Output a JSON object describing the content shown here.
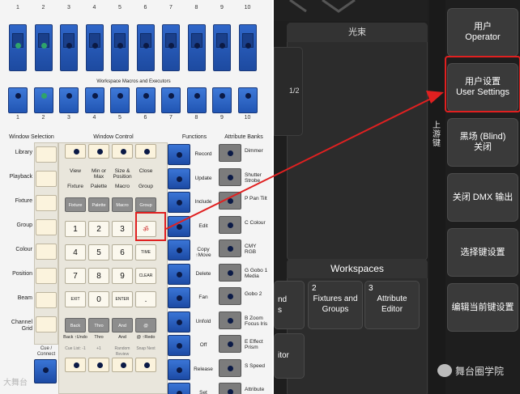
{
  "console": {
    "fader_numbers": [
      "1",
      "2",
      "3",
      "4",
      "5",
      "6",
      "7",
      "8",
      "9",
      "10"
    ],
    "executor_numbers": [
      "1",
      "2",
      "3",
      "4",
      "5",
      "6",
      "7",
      "8",
      "9",
      "10"
    ],
    "macros_label": "Workspace Macros and Executors",
    "section_headers": {
      "window_selection": "Window Selection",
      "window_control": "Window Control",
      "functions": "Functions",
      "attribute_banks": "Attribute Banks"
    },
    "window_selection": [
      "Library",
      "Playback",
      "Fixture",
      "Group",
      "Colour",
      "Position",
      "Beam",
      "Channel Grid"
    ],
    "window_control_top": [
      "View",
      "Min or Max",
      "Size & Position",
      "Close"
    ],
    "window_control_row2": [
      "Fixture",
      "Palette",
      "Macro",
      "Group"
    ],
    "gray_keys": [
      "Fixture",
      "Palette",
      "Macro",
      "Group"
    ],
    "numpad": [
      "1",
      "2",
      "3",
      "4",
      "5",
      "6",
      "7",
      "8",
      "9",
      "EXIT",
      "0",
      "ENTER",
      "."
    ],
    "small_keys": {
      "time": "TIME",
      "clear": "CLEAR"
    },
    "bottom_gray": [
      "Back",
      "Thro",
      "And",
      "@"
    ],
    "bottom_labels": [
      "Back ↑Undo",
      "Thro",
      "And",
      "@ ↑Redo"
    ],
    "bottom_sub": [
      "Cue List: -1",
      "+1",
      "Random Review",
      "Snap Next"
    ],
    "cue_connect": "Cue / Connect",
    "functions": [
      "Record",
      "Update",
      "Include",
      "Edit",
      "Copy ↑Move",
      "Delete",
      "Fan",
      "Unfold",
      "Off",
      "Release",
      "Set"
    ],
    "attribute_banks": [
      "Dimmer",
      "Shutter Strobe",
      "P Pan Tilt",
      "C Colour",
      "CMY RGB",
      "G Gobo 1 Media",
      "Gobo 2",
      "B Zoom Focus Iris",
      "E Effect Prism",
      "S Speed",
      "Attribute"
    ],
    "watermark": "大舞台"
  },
  "screen": {
    "top_bar_label": "光束",
    "left_fragment": "1/2",
    "side_tab": "上游键",
    "workspaces_label": "Workspaces",
    "workspace_buttons": [
      {
        "num": "",
        "label": "nd\ns"
      },
      {
        "num": "2",
        "label": "Fixtures and Groups"
      },
      {
        "num": "3",
        "label": "Attribute Editor"
      }
    ],
    "workspace_fragment": "itor",
    "right_buttons": [
      {
        "line1": "用户",
        "line2": "Operator"
      },
      {
        "line1": "用户设置",
        "line2": "User Settings"
      },
      {
        "line1": "黑场 (Blind)",
        "line2": "关闭"
      },
      {
        "line1": "关闭 DMX 输出",
        "line2": ""
      },
      {
        "line1": "选择键设置",
        "line2": ""
      },
      {
        "line1": "编辑当前键设置",
        "line2": ""
      }
    ],
    "watermark_text": "舞台圈学院"
  },
  "annotation": {
    "color": "#e02020"
  }
}
